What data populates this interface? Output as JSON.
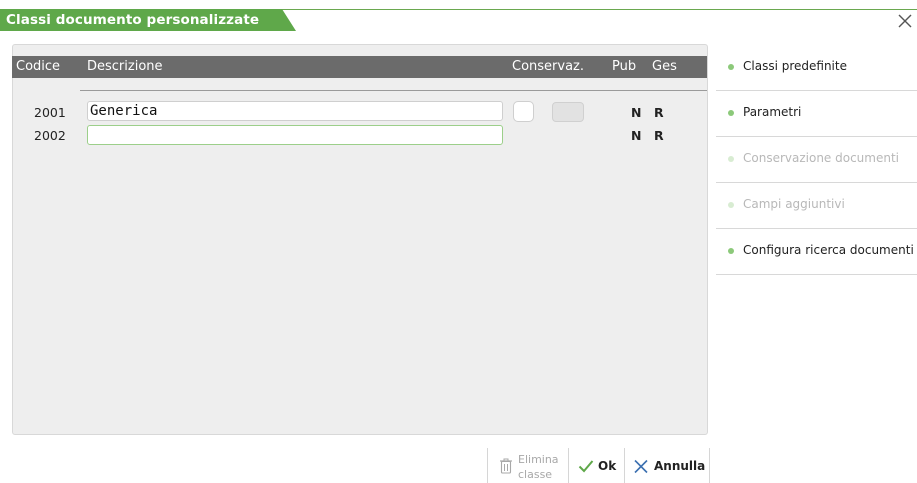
{
  "window": {
    "title": "Classi documento personalizzate",
    "close_icon": "close-icon"
  },
  "table": {
    "headers": {
      "codice": "Codice",
      "descrizione": "Descrizione",
      "conservaz": "Conservaz.",
      "pub": "Pub",
      "ges": "Ges"
    },
    "rows": [
      {
        "codice": "2001",
        "descrizione": "Generica",
        "pub": "N",
        "ges": "R"
      },
      {
        "codice": "2002",
        "descrizione": "",
        "pub": "N",
        "ges": "R"
      }
    ]
  },
  "sidebar": {
    "items": [
      {
        "label": "Classi predefinite",
        "enabled": true
      },
      {
        "label": "Parametri",
        "enabled": true
      },
      {
        "label": "Conservazione documenti",
        "enabled": false
      },
      {
        "label": "Campi aggiuntivi",
        "enabled": false
      },
      {
        "label": "Configura ricerca documenti",
        "enabled": true
      }
    ]
  },
  "buttons": {
    "elimina_line1": "Elimina",
    "elimina_line2": "classe",
    "ok": "Ok",
    "annulla": "Annulla"
  },
  "colors": {
    "accent": "#5fa84a",
    "header_bg": "#6b6b6b",
    "panel_bg": "#eeeeee"
  }
}
